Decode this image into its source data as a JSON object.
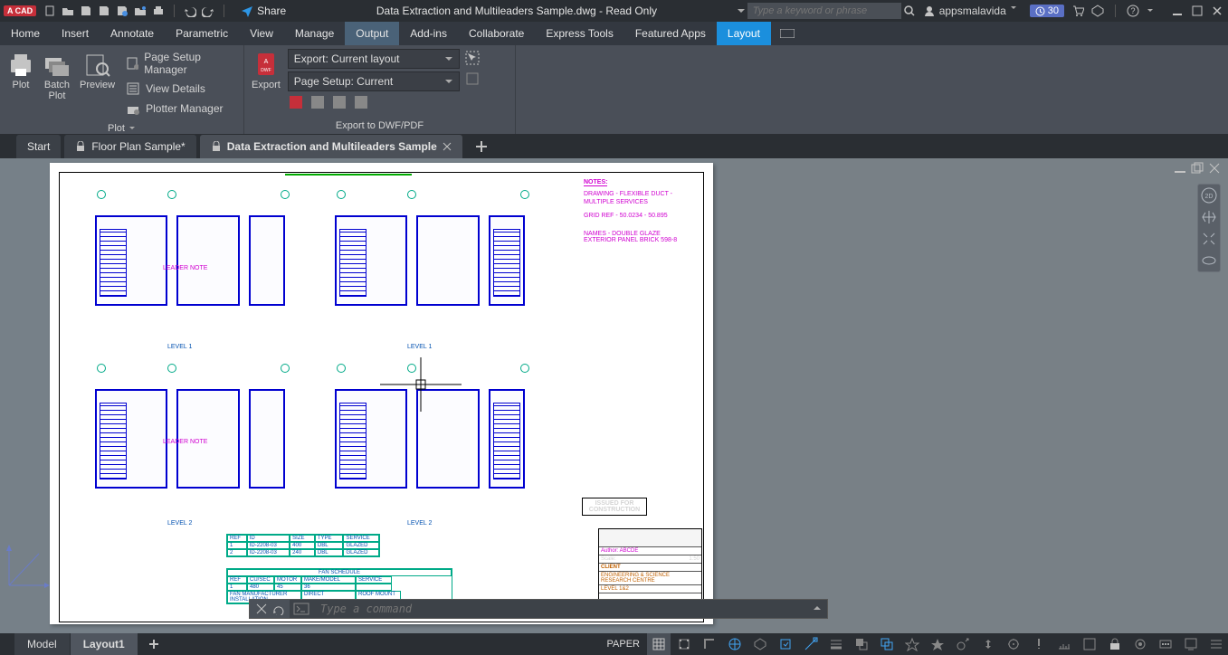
{
  "titlebar": {
    "app_badge": "A CAD",
    "share_label": "Share",
    "document_title": "Data Extraction and Multileaders Sample.dwg - Read Only",
    "search_placeholder": "Type a keyword or phrase",
    "username": "appsmalavida",
    "trial_days": "30"
  },
  "menu": {
    "tabs": [
      "Home",
      "Insert",
      "Annotate",
      "Parametric",
      "View",
      "Manage",
      "Output",
      "Add-ins",
      "Collaborate",
      "Express Tools",
      "Featured Apps",
      "Layout"
    ],
    "active": "Output"
  },
  "ribbon": {
    "plot": {
      "plot": "Plot",
      "batch_plot": "Batch\nPlot",
      "preview": "Preview",
      "page_setup": "Page Setup Manager",
      "view_details": "View Details",
      "plotter_manager": "Plotter Manager",
      "panel": "Plot"
    },
    "export": {
      "export": "Export",
      "export_dd": "Export: Current layout",
      "page_setup_dd": "Page Setup: Current",
      "panel": "Export to DWF/PDF"
    }
  },
  "filetabs": {
    "start": "Start",
    "floor_plan": "Floor Plan Sample*",
    "data_extraction": "Data Extraction and Multileaders Sample"
  },
  "drawing": {
    "level1": "LEVEL 1",
    "level2": "LEVEL 2",
    "notes_title": "NOTES:",
    "issued_box": "ISSUED FOR\nCONSTRUCTION",
    "titleblock": {
      "client_label": "CLIENT",
      "client": "ENGINEERING & SCIENCE RESEARCH CENTRE",
      "level": "LEVEL 1&2"
    },
    "schedule_title": "FAN SCHEDULE"
  },
  "command": {
    "placeholder": "Type a command"
  },
  "status": {
    "model": "Model",
    "layout1": "Layout1",
    "paper": "PAPER"
  }
}
